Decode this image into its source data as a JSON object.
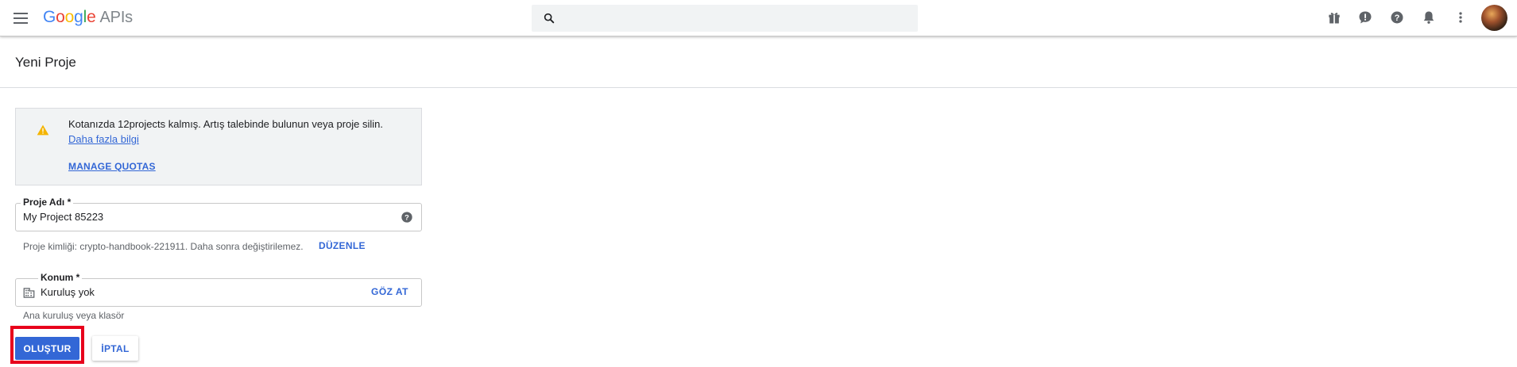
{
  "header": {
    "logo_google": "Google",
    "logo_suffix": "APIs",
    "search_placeholder": "",
    "icons": [
      "menu-icon",
      "search-icon",
      "gift-icon",
      "feedback-icon",
      "help-icon",
      "notifications-icon",
      "more-vert-icon",
      "avatar"
    ]
  },
  "page": {
    "title": "Yeni Proje"
  },
  "quota_warning": {
    "message": "Kotanızda 12projects kalmış. Artış talebinde bulunun veya proje silin.",
    "learn_more": "Daha fazla bilgi",
    "manage_quotas": "MANAGE QUOTAS"
  },
  "project_name": {
    "label": "Proje Adı *",
    "value": "My Project 85223"
  },
  "project_id": {
    "text": "Proje kimliği: crypto-handbook-221911. Daha sonra değiştirilemez.",
    "edit_label": "DÜZENLE"
  },
  "location": {
    "label": "Konum *",
    "value": "Kuruluş yok",
    "browse_label": "GÖZ AT",
    "hint": "Ana kuruluş veya klasör"
  },
  "actions": {
    "create_label": "OLUŞTUR",
    "cancel_label": "İPTAL"
  },
  "colors": {
    "accent": "#3367d6",
    "highlight": "#e8001c",
    "warning": "#f4b400"
  }
}
